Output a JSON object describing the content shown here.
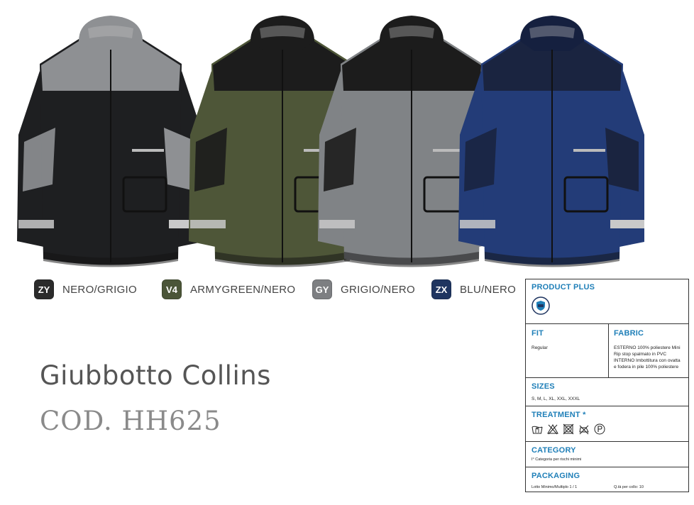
{
  "product": {
    "name": "Giubbotto Collins",
    "code": "COD. HH625"
  },
  "colors": [
    {
      "code": "ZY",
      "label": "NERO/GRIGIO",
      "badge_color": "#2b2b2b"
    },
    {
      "code": "V4",
      "label": "ARMYGREEN/NERO",
      "badge_color": "#4b5538"
    },
    {
      "code": "GY",
      "label": "GRIGIO/NERO",
      "badge_color": "#7d7f82"
    },
    {
      "code": "ZX",
      "label": "BLU/NERO",
      "badge_color": "#1f3560"
    }
  ],
  "jackets": [
    {
      "name": "jacket-nero-grigio",
      "body": "#1e1f21",
      "accent": "#8e9093",
      "collar": "#8e9093"
    },
    {
      "name": "jacket-armygreen-nero",
      "body": "#4e5638",
      "accent": "#1c1c1c",
      "collar": "#1c1c1c"
    },
    {
      "name": "jacket-grigio-nero",
      "body": "#808386",
      "accent": "#1c1c1c",
      "collar": "#1c1c1c"
    },
    {
      "name": "jacket-blu-nero",
      "body": "#233c78",
      "accent": "#1a2440",
      "collar": "#15203f"
    }
  ],
  "spec": {
    "product_plus": {
      "title": "PRODUCT PLUS",
      "icon": "shield-badge-icon"
    },
    "fit": {
      "title": "FIT",
      "text": "Regular"
    },
    "fabric": {
      "title": "FABRIC",
      "lines": [
        "ESTERNO 100% poliestere Mini",
        "Rip stop spalmato in PVC",
        "INTERNO Imbottitura con ovatta",
        "e fodera in pile 100% poliestere"
      ]
    },
    "sizes": {
      "title": "SIZES",
      "text": "S, M, L, XL, XXL, XXXL"
    },
    "treatment": {
      "title": "TREATMENT *",
      "icons": [
        "wash-hand-icon",
        "no-bleach-icon",
        "no-tumble-dry-icon",
        "no-iron-icon",
        "dry-clean-p-icon"
      ]
    },
    "category": {
      "title": "CATEGORY",
      "text": "I° Categoria per rischi minimi"
    },
    "packaging": {
      "title": "PACKAGING",
      "left": "Lotto Minimo/Multiplo 1 / 1",
      "right": "Q.tà per collo: 10"
    }
  }
}
